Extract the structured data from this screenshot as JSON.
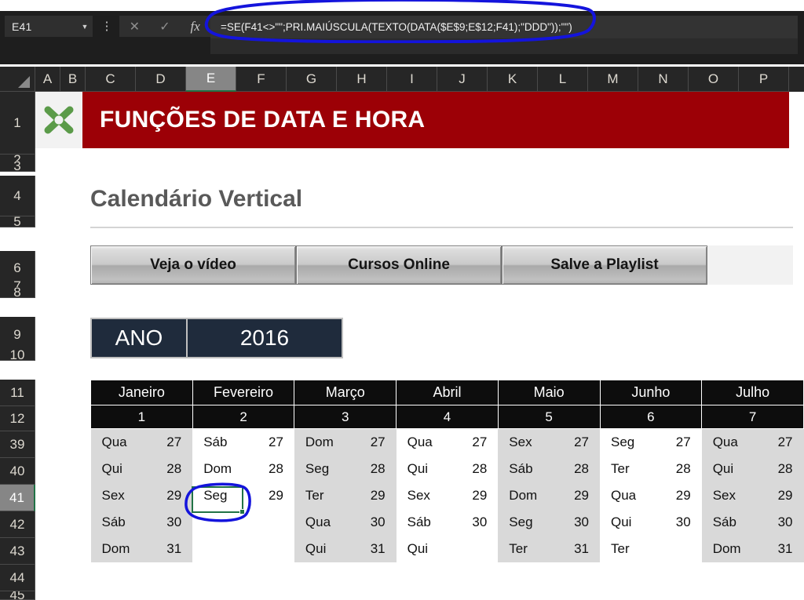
{
  "app": {
    "name_box_value": "E41",
    "formula": "=SE(F41<>\"\";PRI.MAIÚSCULA(TEXTO(DATA($E$9;E$12;F41);\"DDD\"));\"\")",
    "cancel_icon": "✕",
    "enter_icon": "✓",
    "function_icon": "fx",
    "dropdown_icon": "▼",
    "more_icon": "⋮"
  },
  "grid": {
    "columns": [
      "A",
      "B",
      "C",
      "D",
      "E",
      "F",
      "G",
      "H",
      "I",
      "J",
      "K",
      "L",
      "M",
      "N",
      "O",
      "P"
    ],
    "selected_column": "E",
    "rows": [
      "1",
      "2",
      "3",
      "4",
      "5",
      "6",
      "7",
      "8",
      "9",
      "10",
      "11",
      "12",
      "39",
      "40",
      "41",
      "42",
      "43",
      "44",
      "45"
    ],
    "selected_row": "41"
  },
  "banner": {
    "title": "FUNÇÕES DE DATA E HORA",
    "logo_name": "excel-x-logo",
    "background_color": "#9c0006"
  },
  "section": {
    "title": "Calendário Vertical"
  },
  "buttons": [
    {
      "label": "Veja o vídeo"
    },
    {
      "label": "Cursos Online"
    },
    {
      "label": "Salve a Playlist"
    }
  ],
  "year_selector": {
    "label": "ANO",
    "value": "2016"
  },
  "calendar": {
    "months": [
      {
        "name": "Janeiro",
        "number": "1"
      },
      {
        "name": "Fevereiro",
        "number": "2"
      },
      {
        "name": "Março",
        "number": "3"
      },
      {
        "name": "Abril",
        "number": "4"
      },
      {
        "name": "Maio",
        "number": "5"
      },
      {
        "name": "Junho",
        "number": "6"
      },
      {
        "name": "Julho",
        "number": "7"
      }
    ],
    "rows": [
      {
        "row_number": "39",
        "cells": [
          {
            "dow": "Qua",
            "day": "27"
          },
          {
            "dow": "Sáb",
            "day": "27"
          },
          {
            "dow": "Dom",
            "day": "27"
          },
          {
            "dow": "Qua",
            "day": "27"
          },
          {
            "dow": "Sex",
            "day": "27"
          },
          {
            "dow": "Seg",
            "day": "27"
          },
          {
            "dow": "Qua",
            "day": "27"
          }
        ]
      },
      {
        "row_number": "40",
        "cells": [
          {
            "dow": "Qui",
            "day": "28"
          },
          {
            "dow": "Dom",
            "day": "28"
          },
          {
            "dow": "Seg",
            "day": "28"
          },
          {
            "dow": "Qui",
            "day": "28"
          },
          {
            "dow": "Sáb",
            "day": "28"
          },
          {
            "dow": "Ter",
            "day": "28"
          },
          {
            "dow": "Qui",
            "day": "28"
          }
        ]
      },
      {
        "row_number": "41",
        "cells": [
          {
            "dow": "Sex",
            "day": "29"
          },
          {
            "dow": "Seg",
            "day": "29"
          },
          {
            "dow": "Ter",
            "day": "29"
          },
          {
            "dow": "Sex",
            "day": "29"
          },
          {
            "dow": "Dom",
            "day": "29"
          },
          {
            "dow": "Qua",
            "day": "29"
          },
          {
            "dow": "Sex",
            "day": "29"
          }
        ]
      },
      {
        "row_number": "42",
        "cells": [
          {
            "dow": "Sáb",
            "day": "30"
          },
          {
            "dow": "",
            "day": ""
          },
          {
            "dow": "Qua",
            "day": "30"
          },
          {
            "dow": "Sáb",
            "day": "30"
          },
          {
            "dow": "Seg",
            "day": "30"
          },
          {
            "dow": "Qui",
            "day": "30"
          },
          {
            "dow": "Sáb",
            "day": "30"
          }
        ]
      },
      {
        "row_number": "43",
        "cells": [
          {
            "dow": "Dom",
            "day": "31"
          },
          {
            "dow": "",
            "day": ""
          },
          {
            "dow": "Qui",
            "day": "31"
          },
          {
            "dow": "Qui",
            "day": ""
          },
          {
            "dow": "Ter",
            "day": "31"
          },
          {
            "dow": "Ter",
            "day": ""
          },
          {
            "dow": "Dom",
            "day": "31"
          }
        ]
      }
    ]
  },
  "annotations": {
    "color": "#1414dc",
    "formula_circle_name": "formula-bar-annotation",
    "cell_circle_name": "selected-cell-annotation"
  }
}
